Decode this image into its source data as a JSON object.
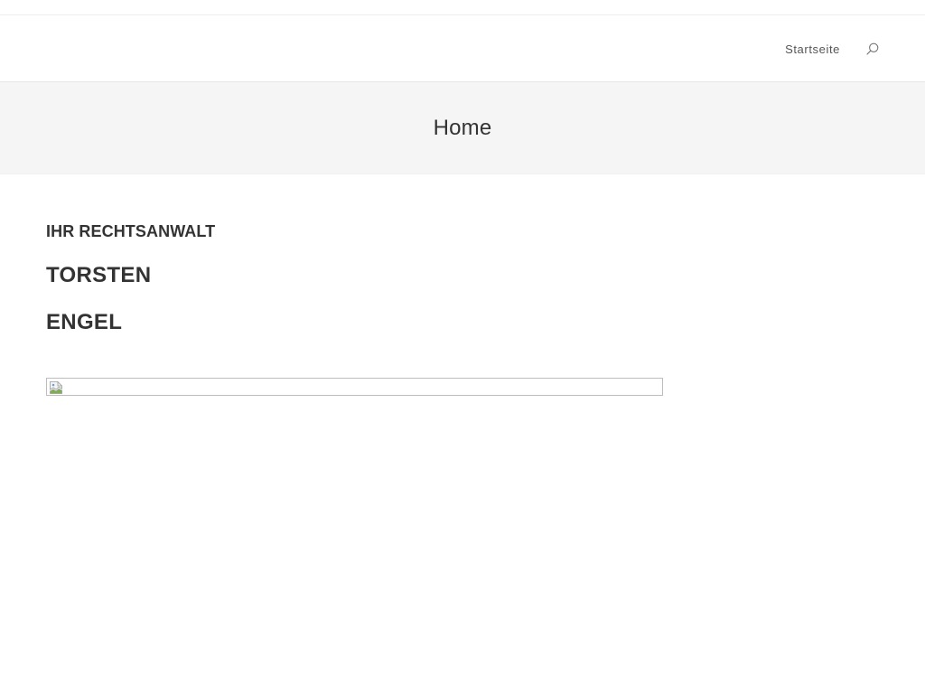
{
  "header": {
    "nav_items": [
      {
        "label": "Startseite"
      }
    ],
    "search_icon": "search-icon"
  },
  "page_header": {
    "title": "Home"
  },
  "main": {
    "kicker": "IHR RECHTSANWALT",
    "first_name": "TORSTEN",
    "last_name": "ENGEL",
    "image": {
      "state": "broken",
      "icon": "broken-image-icon"
    }
  },
  "colors": {
    "text": "#333333",
    "page_header_bg": "#f5f5f5",
    "nav_text": "#555555",
    "border": "#e6e6e6"
  }
}
